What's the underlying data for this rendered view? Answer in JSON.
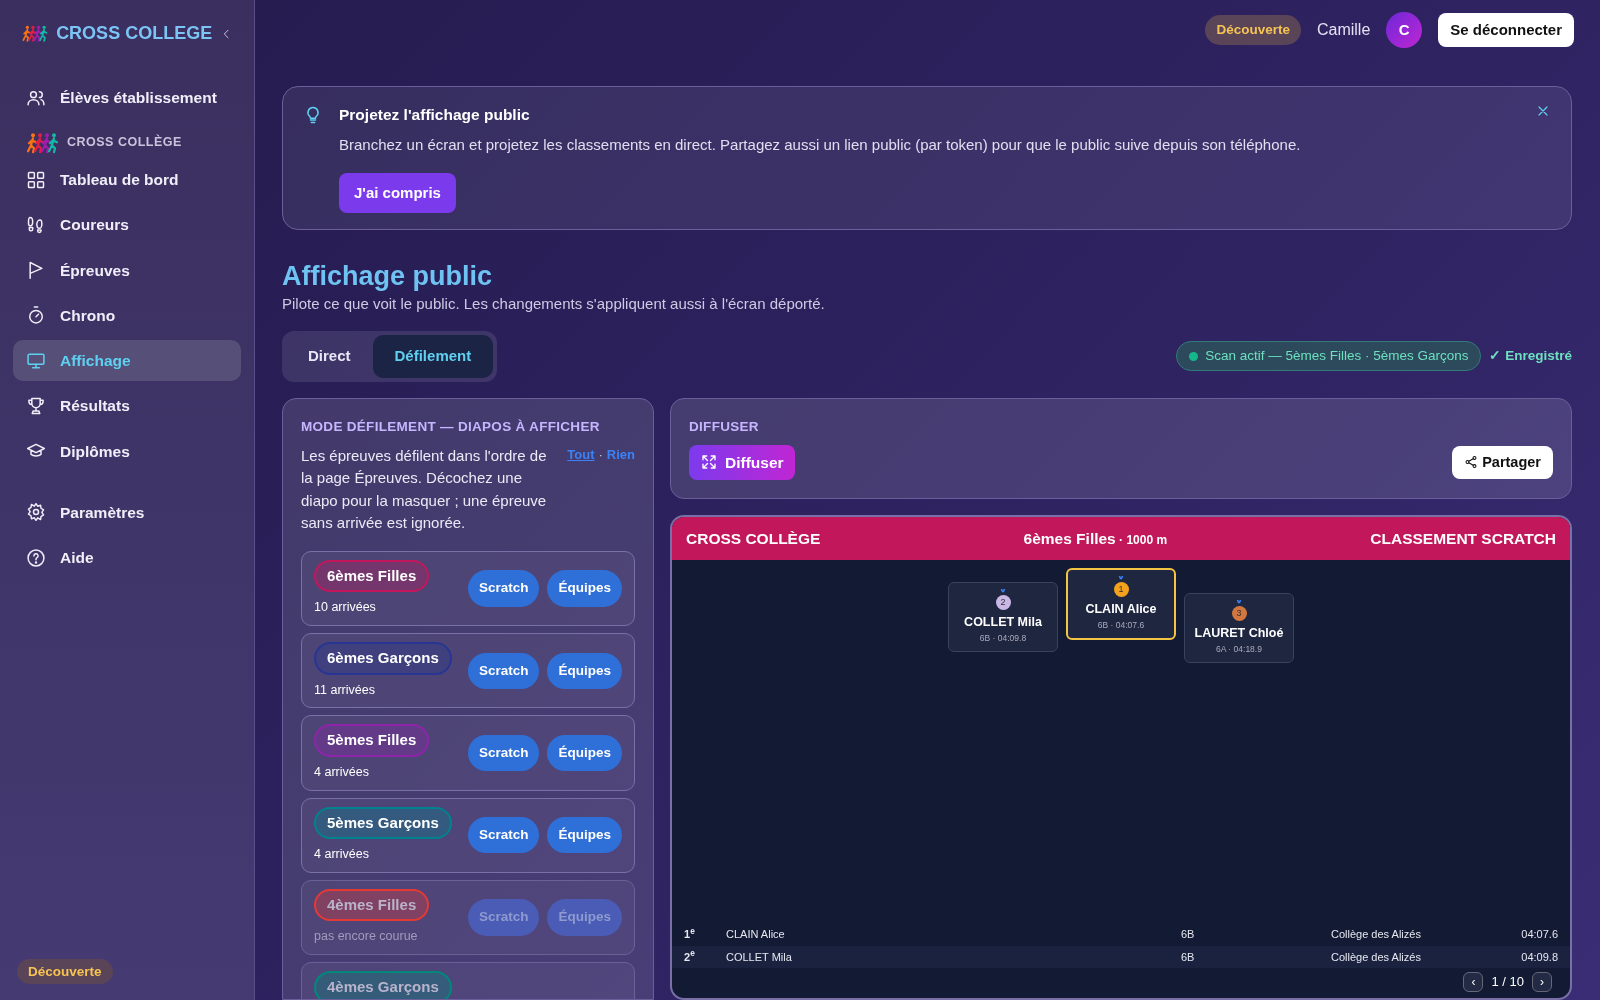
{
  "sidebar": {
    "brand": "CROSS COLLEGE",
    "sections": [
      {
        "items": [
          {
            "label": "Élèves établissement",
            "selected": false
          }
        ]
      },
      {
        "title": "CROSS COLLÈGE",
        "items": [
          {
            "label": "Tableau de bord",
            "selected": false
          },
          {
            "label": "Coureurs",
            "selected": false
          },
          {
            "label": "Épreuves",
            "selected": false
          },
          {
            "label": "Chrono",
            "selected": false
          },
          {
            "label": "Affichage",
            "selected": true
          },
          {
            "label": "Résultats",
            "selected": false
          },
          {
            "label": "Diplômes",
            "selected": false
          }
        ]
      },
      {
        "items": [
          {
            "label": "Paramètres",
            "selected": false
          },
          {
            "label": "Aide",
            "selected": false
          }
        ]
      }
    ],
    "footer_badge": "Découverte"
  },
  "topbar": {
    "plan_badge": "Découverte",
    "user": "Camille",
    "avatar": "C",
    "logout": "Se déconnecter"
  },
  "tip": {
    "title": "Projetez l'affichage public",
    "text": "Branchez un écran et projetez les classements en direct. Partagez aussi un lien public (par token) pour que le public suive depuis son téléphone.",
    "button": "J'ai compris"
  },
  "page": {
    "title": "Affichage public",
    "subtitle": "Pilote ce que voit le public. Les changements s'appliquent aussi à l'écran déporté."
  },
  "modes": [
    {
      "label": "Direct",
      "selected": false
    },
    {
      "label": "Défilement",
      "selected": true
    }
  ],
  "scan_status": "Scan actif — 5èmes Filles · 5èmes Garçons",
  "save_status": "✓ Enregistré",
  "slides_panel": {
    "title": "MODE DÉFILEMENT — DIAPOS À AFFICHER",
    "text": "Les épreuves défilent dans l'ordre de la page Épreuves. Décochez une diapo pour la masquer ; une épreuve sans arrivée est ignorée.",
    "select_all": "Tout",
    "separator": "·",
    "select_none": "Rien",
    "events": [
      {
        "name": "6èmes Filles",
        "color": "#c2185b",
        "info": "10 arrivées",
        "available": true,
        "buttons": [
          "Scratch",
          "Équipes"
        ]
      },
      {
        "name": "6èmes Garçons",
        "color": "#283593",
        "info": "11 arrivées",
        "available": true,
        "buttons": [
          "Scratch",
          "Équipes"
        ]
      },
      {
        "name": "5èmes Filles",
        "color": "#8e24aa",
        "info": "4 arrivées",
        "available": true,
        "buttons": [
          "Scratch",
          "Équipes"
        ]
      },
      {
        "name": "5èmes Garçons",
        "color": "#00838f",
        "info": "4 arrivées",
        "available": true,
        "buttons": [
          "Scratch",
          "Équipes"
        ]
      },
      {
        "name": "4èmes Filles",
        "color": "#e53935",
        "info": "pas encore courue",
        "available": false,
        "buttons": [
          "Scratch",
          "Équipes"
        ]
      },
      {
        "name": "4èmes Garçons",
        "color": "#00897b",
        "available": false
      }
    ]
  },
  "broadcast": {
    "title": "DIFFUSER",
    "button": "Diffuser",
    "share": "Partager"
  },
  "preview": {
    "brand": "CROSS COLLÈGE",
    "event": "6èmes Filles",
    "distance": "· 1000 m",
    "mode": "CLASSEMENT SCRATCH",
    "podium": [
      {
        "rank": "2",
        "name": "COLLET Mila",
        "detail": "6B · 04:09.8"
      },
      {
        "rank": "1",
        "name": "CLAIN Alice",
        "detail": "6B · 04:07.6"
      },
      {
        "rank": "3",
        "name": "LAURET Chloé",
        "detail": "6A · 04:18.9"
      }
    ],
    "rows": [
      {
        "rank": "1$^{e}$",
        "name": "CLAIN Alice",
        "class": "6B",
        "school": "Collège des Alizés",
        "time": "04:07.6"
      },
      {
        "rank": "2$^{e}$",
        "name": "COLLET Mila",
        "class": "6B",
        "school": "Collège des Alizés",
        "time": "04:09.8"
      }
    ],
    "pager": {
      "prev": "‹",
      "page": "1 / 10",
      "next": "›"
    }
  }
}
